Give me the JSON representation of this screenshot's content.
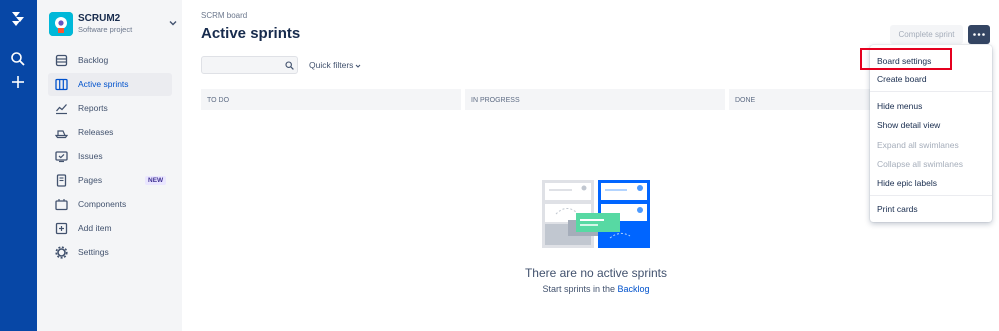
{
  "project": {
    "name": "SCRUM2",
    "type": "Software project"
  },
  "sidebar": {
    "items": [
      {
        "label": "Backlog",
        "icon": "backlog-icon"
      },
      {
        "label": "Active sprints",
        "icon": "board-icon",
        "selected": true
      },
      {
        "label": "Reports",
        "icon": "reports-icon"
      },
      {
        "label": "Releases",
        "icon": "releases-icon"
      },
      {
        "label": "Issues",
        "icon": "issues-icon"
      },
      {
        "label": "Pages",
        "icon": "pages-icon",
        "badge": "NEW"
      },
      {
        "label": "Components",
        "icon": "components-icon"
      },
      {
        "label": "Add item",
        "icon": "add-item-icon"
      },
      {
        "label": "Settings",
        "icon": "settings-icon"
      }
    ]
  },
  "header": {
    "breadcrumb": "SCRM board",
    "title": "Active sprints",
    "complete_label": "Complete sprint"
  },
  "filters": {
    "search_placeholder": "",
    "quick_filters_label": "Quick filters"
  },
  "board": {
    "columns": [
      "TO DO",
      "IN PROGRESS",
      "DONE"
    ]
  },
  "empty_state": {
    "title": "There are no active sprints",
    "subtitle_prefix": "Start sprints in the",
    "subtitle_link": "Backlog"
  },
  "menu": {
    "items": [
      {
        "label": "Board settings",
        "disabled": false
      },
      {
        "label": "Create board",
        "disabled": false
      },
      {
        "label": "Hide menus",
        "disabled": false
      },
      {
        "label": "Show detail view",
        "disabled": false
      },
      {
        "label": "Expand all swimlanes",
        "disabled": true
      },
      {
        "label": "Collapse all swimlanes",
        "disabled": true
      },
      {
        "label": "Hide epic labels",
        "disabled": false
      },
      {
        "label": "Print cards",
        "disabled": false
      }
    ]
  },
  "colors": {
    "nav_bg": "#0747a6",
    "accent": "#0052cc",
    "highlight": "#e5001f"
  }
}
